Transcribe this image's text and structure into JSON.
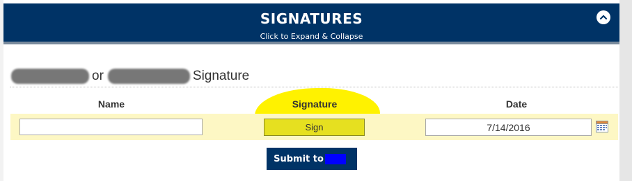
{
  "header": {
    "title": "SIGNATURES",
    "subtitle": "Click to Expand & Collapse",
    "collapse_icon": "chevron-up-icon"
  },
  "section": {
    "heading_middle": "or",
    "heading_suffix": "Signature"
  },
  "columns": {
    "name": "Name",
    "signature": "Signature",
    "date": "Date"
  },
  "row": {
    "name_value": "",
    "sign_label": "Sign",
    "date_value": "7/14/2016",
    "calendar_icon": "calendar-icon"
  },
  "submit": {
    "label": "Submit to"
  },
  "colors": {
    "header_bg": "#003366",
    "row_bg": "#fdf7c4",
    "highlight": "#fff200",
    "sign_button": "#e6e020"
  }
}
